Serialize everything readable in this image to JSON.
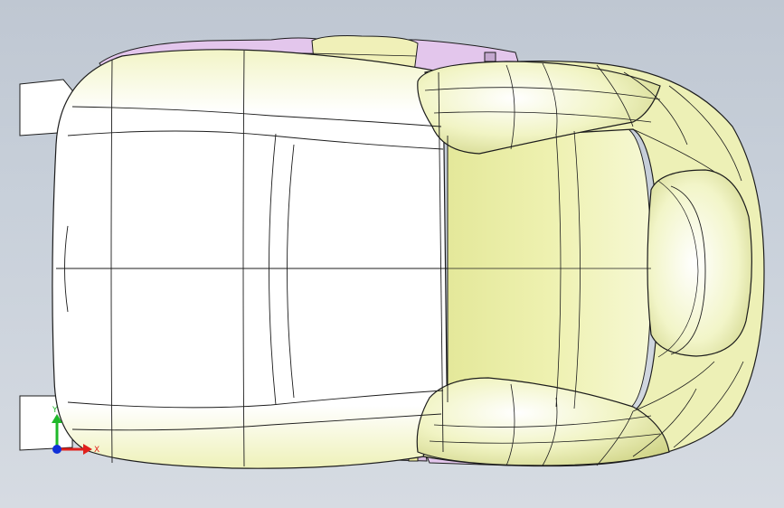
{
  "viewport": {
    "background_top": "#bfc7d2",
    "background_bottom": "#d6dbe2"
  },
  "model": {
    "surface_color": "#f4f6c2",
    "surface_shade": "#e6ea9a",
    "accent_part_color": "#e3c6ec",
    "edge_color": "#1c1c1c"
  },
  "triad": {
    "x_label": "X",
    "y_label": "Y",
    "x_color": "#e0201c",
    "y_color": "#1fb82a",
    "z_color": "#1030d8"
  }
}
